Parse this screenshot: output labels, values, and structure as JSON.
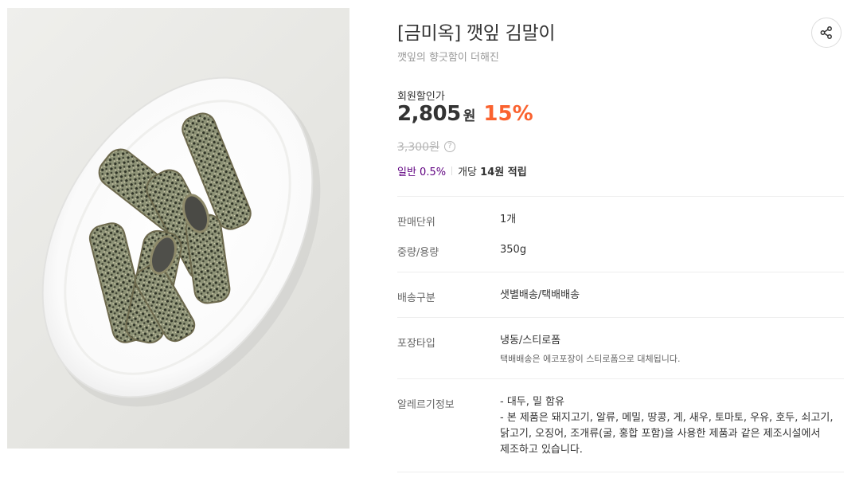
{
  "product": {
    "title": "[금미옥] 깻잎 김말이",
    "subtitle": "깻잎의 향긋함이 더해진",
    "image_alt": "깻잎 김말이 plated on a white oval dish"
  },
  "price": {
    "label": "회원할인가",
    "value": "2,805",
    "currency": "원",
    "discount": "15%",
    "original": "3,300원"
  },
  "points": {
    "grade": "일반 0.5%",
    "text_prefix": "개당 ",
    "amount": "14원 적립"
  },
  "specs": {
    "unit": {
      "label": "판매단위",
      "value": "1개"
    },
    "weight": {
      "label": "중량/용량",
      "value": "350g"
    },
    "delivery": {
      "label": "배송구분",
      "value": "샛별배송/택배배송"
    },
    "packaging": {
      "label": "포장타입",
      "value": "냉동/스티로폼",
      "note": "택배배송은 에코포장이 스티로폼으로 대체됩니다."
    },
    "allergy": {
      "label": "알레르기정보",
      "line1": "- 대두, 밀 함유",
      "line2": "- 본 제품은 돼지고기, 알류, 메밀, 땅콩, 게, 새우, 토마토, 우유, 호두, 쇠고기, 닭고기, 오징어, 조개류(굴, 홍합 포함)을 사용한 제품과 같은 제조시설에서 제조하고 있습니다."
    }
  },
  "icons": {
    "share": "share-icon",
    "help": "question-circle-icon"
  },
  "colors": {
    "discount": "#fa622f",
    "points_grade": "#5f0080",
    "strike_price": "#b5b5b5"
  }
}
